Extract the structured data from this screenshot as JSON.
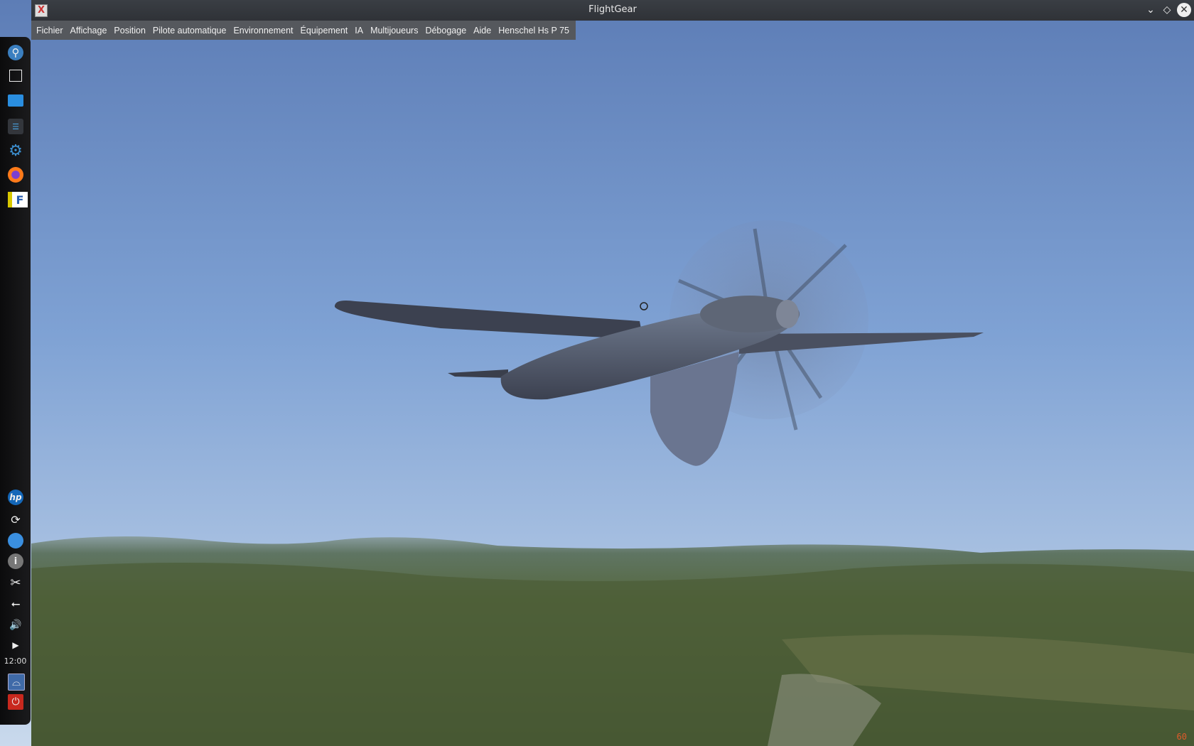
{
  "window": {
    "title": "FlightGear"
  },
  "menu": [
    "Fichier",
    "Affichage",
    "Position",
    "Pilote automatique",
    "Environnement",
    "Équipement",
    "IA",
    "Multijoueurs",
    "Débogage",
    "Aide",
    "Henschel Hs P 75"
  ],
  "dock": {
    "top_icons": [
      "app-launcher-icon",
      "desktop-icon",
      "file-manager-icon",
      "settings-icon",
      "system-settings-gear-icon",
      "firefox-icon",
      "flightgear-icon"
    ],
    "tray_icons": [
      "hp-icon",
      "update-icon",
      "network-icon",
      "info-icon",
      "screenshot-scissors-icon",
      "usb-icon",
      "volume-icon",
      "expand-arrow-icon"
    ],
    "clock": "12:00",
    "bottom_icons": [
      "lock-screen-icon",
      "power-icon"
    ]
  },
  "hud": {
    "fps": "60"
  },
  "colors": {
    "sky_top": "#5f7fb8",
    "sky_horizon": "#c6d6ea",
    "terrain": "#4d5e3a",
    "fps": "#e05a2a"
  }
}
